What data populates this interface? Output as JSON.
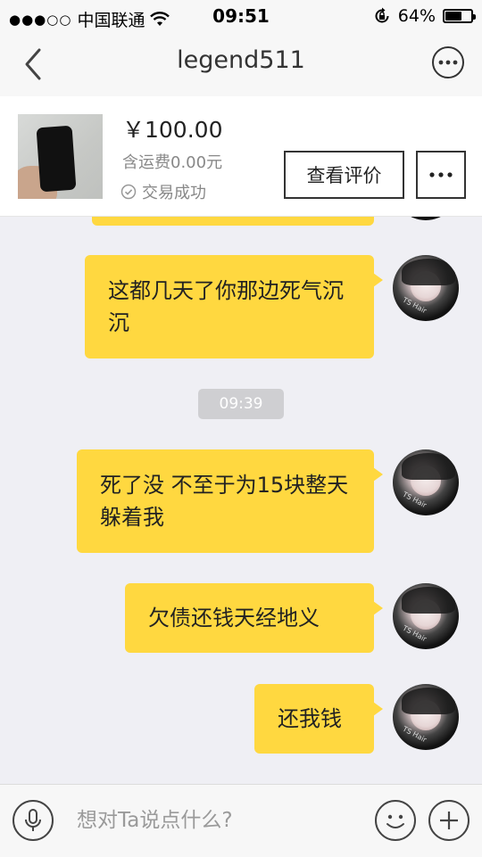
{
  "status_bar": {
    "signal": "●●●○○",
    "carrier": "中国联通",
    "wifi_icon": "wifi-icon",
    "time": "09:51",
    "orientation_lock_icon": "orientation-lock-icon",
    "battery_text": "64%",
    "battery_level": 0.64
  },
  "nav": {
    "back_icon": "chevron-left-icon",
    "title": "legend511",
    "more_icon": "more-icon"
  },
  "product": {
    "thumbnail": "phone-photo",
    "price": "￥100.00",
    "shipping": "含运费0.00元",
    "trade_status": "交易成功",
    "review_button": "查看评价",
    "more_icon": "more-icon"
  },
  "chat": {
    "messages": [
      {
        "text": "",
        "from": "self"
      },
      {
        "text": "这都几天了你那边死气沉沉",
        "from": "self"
      },
      {
        "text": "死了没 不至于为15块整天躲着我",
        "from": "self"
      },
      {
        "text": "欠债还钱天经地义",
        "from": "self"
      },
      {
        "text": "还我钱",
        "from": "self"
      }
    ],
    "time_divider": "09:39",
    "avatar_tag": "TS Hair"
  },
  "input_bar": {
    "mic_icon": "microphone-icon",
    "placeholder": "想对Ta说点什么?",
    "emoji_icon": "smiley-icon",
    "plus_icon": "plus-icon"
  },
  "colors": {
    "bubble": "#ffd840",
    "background": "#efeff4",
    "time_chip": "#cfcfd2"
  }
}
